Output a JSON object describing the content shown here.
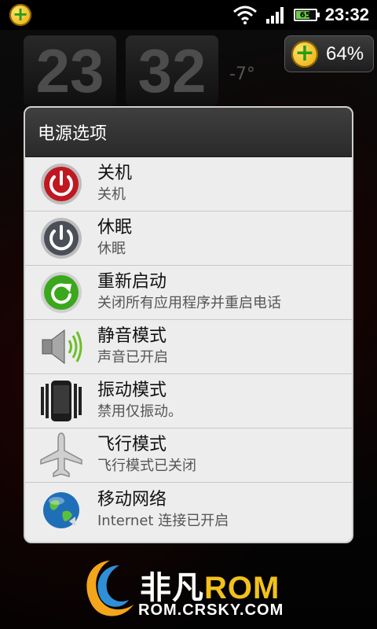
{
  "status_bar": {
    "time": "23:32",
    "battery_level": "65",
    "battery_fraction": 0.65
  },
  "home_screen": {
    "clock_hours": "23",
    "clock_minutes": "32",
    "weather_temp": "-7°"
  },
  "memory_widget": {
    "percent": "64%"
  },
  "dialog": {
    "title": "电源选项",
    "items": [
      {
        "icon": "power-icon",
        "title": "关机",
        "subtitle": "关机"
      },
      {
        "icon": "sleep-icon",
        "title": "休眠",
        "subtitle": "休眠"
      },
      {
        "icon": "restart-icon",
        "title": "重新启动",
        "subtitle": "关闭所有应用程序并重启电话"
      },
      {
        "icon": "speaker-icon",
        "title": "静音模式",
        "subtitle": "声音已开启"
      },
      {
        "icon": "vibrate-icon",
        "title": "振动模式",
        "subtitle": "禁用仅振动。"
      },
      {
        "icon": "airplane-icon",
        "title": "飞行模式",
        "subtitle": "飞行模式已关闭"
      },
      {
        "icon": "globe-icon",
        "title": "移动网络",
        "subtitle": "Internet 连接已开启"
      }
    ]
  },
  "watermark": {
    "brand": "非凡",
    "rom": "ROM",
    "url": "ROM.CRSKY.COM"
  },
  "colors": {
    "power_red": "#c01820",
    "restart_green": "#3aa81c",
    "dialog_bg": "#ececec",
    "header_bg": "#333333"
  }
}
